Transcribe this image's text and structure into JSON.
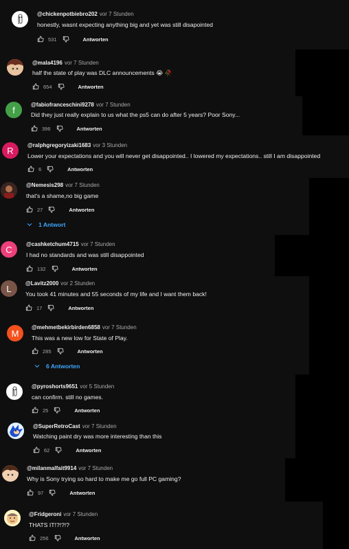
{
  "comments": [
    {
      "handle": "@chickenpotbiebro202",
      "time": "vor 7 Stunden",
      "text": "honestly, wasnt expecting anything big and yet was still disapointed",
      "likes": "531",
      "reply_label": "Antworten",
      "avatar": {
        "letter": "",
        "color": "#ffffff",
        "icon": "clippy-avatar"
      }
    },
    {
      "handle": "@mala4196",
      "time": "vor 7 Stunden",
      "text": "half the state of play was DLC announcements 😭 🥀",
      "likes": "654",
      "reply_label": "Antworten",
      "avatar": {
        "letter": "",
        "color": "#c98a70",
        "icon": "anime-avatar"
      }
    },
    {
      "handle": "@fabiofranceschini9278",
      "time": "vor 7 Stunden",
      "text": "Did they just really explain to us what the ps5 can do after 5 years? Poor Sony...",
      "likes": "396",
      "reply_label": "Antworten",
      "avatar": {
        "letter": "f",
        "color": "#43a047"
      }
    },
    {
      "handle": "@ralphgregoryizaki1683",
      "time": "vor 3 Stunden",
      "text": "Lower your expectations and you will never get disappointed.. I lowered my expectations.. still I am disappointed",
      "likes": "6",
      "reply_label": "Antworten",
      "avatar": {
        "letter": "R",
        "color": "#d81b60"
      }
    },
    {
      "handle": "@Nemesis298",
      "time": "vor 7 Stunden",
      "text": "that's a shame,no big game",
      "likes": "27",
      "reply_label": "Antworten",
      "avatar": {
        "letter": "",
        "color": "#6a3a2a",
        "icon": "photo-avatar"
      },
      "replies": "1 Antwort"
    },
    {
      "handle": "@cashketchum4715",
      "time": "vor 7 Stunden",
      "text": "I had no standards and was still disappointed",
      "likes": "132",
      "reply_label": "Antworten",
      "avatar": {
        "letter": "C",
        "color": "#ec407a"
      }
    },
    {
      "handle": "@Lavitz2000",
      "time": "vor 2 Stunden",
      "text": "You took 41 minutes and 55 seconds of my life and I want them back!",
      "likes": "17",
      "reply_label": "Antworten",
      "avatar": {
        "letter": "L",
        "color": "#795548"
      }
    },
    {
      "handle": "@mehmetbekirbirden6858",
      "time": "vor 7 Stunden",
      "text": "This was a new low for State of Play.",
      "likes": "285",
      "reply_label": "Antworten",
      "avatar": {
        "letter": "M",
        "color": "#f4511e"
      },
      "replies": "6 Antworten"
    },
    {
      "handle": "@pyroshorts9651",
      "time": "vor 5 Stunden",
      "text": "can confirm. still no games.",
      "likes": "25",
      "reply_label": "Antworten",
      "avatar": {
        "letter": "",
        "color": "#ffffff",
        "icon": "clippy-avatar"
      }
    },
    {
      "handle": "@SuperRetroCast",
      "time": "vor 7 Stunden",
      "text": "Watching paint dry was more interesting than this",
      "likes": "62",
      "reply_label": "Antworten",
      "avatar": {
        "letter": "",
        "color": "#1565c0",
        "icon": "sonic-avatar"
      }
    },
    {
      "handle": "@milanmalfait9914",
      "time": "vor 7 Stunden",
      "text": "Why is Sony trying so hard to make me go full PC gaming?",
      "likes": "97",
      "reply_label": "Antworten",
      "avatar": {
        "letter": "",
        "color": "#5d4037",
        "icon": "anime-avatar"
      }
    },
    {
      "handle": "@Fridgeroni",
      "time": "vor 7 Stunden",
      "text": "THATS IT!?!?!?",
      "likes": "256",
      "reply_label": "Antworten",
      "avatar": {
        "letter": "",
        "color": "#ffe082",
        "icon": "face-avatar"
      }
    }
  ]
}
